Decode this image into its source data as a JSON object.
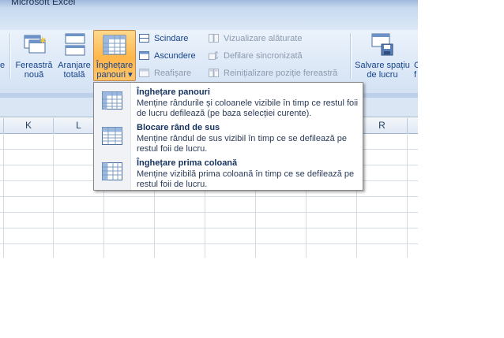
{
  "window": {
    "title": "Microsoft Excel"
  },
  "ribbon": {
    "fereastra_noua": "Fereastră\nnouă",
    "aranjare_totala": "Aranjare\ntotală",
    "inghetare_panouri": "Înghețare\npanouri ▾",
    "scindare": "Scindare",
    "ascundere": "Ascundere",
    "reafisare": "Reafișare",
    "vizualizare_alaturate": "Vizualizare alăturate",
    "defilare_sincronizata": "Defilare sincronizată",
    "reinitializare": "Reinițializare poziție fereastră",
    "salvare_spatiu": "Salvare spațiu\nde lucru",
    "cut_left": "e",
    "cut_right_1": "C",
    "cut_right_2": "f"
  },
  "grid": {
    "columns": [
      "K",
      "L",
      "",
      "",
      "",
      "",
      "",
      "R"
    ]
  },
  "menu": {
    "items": [
      {
        "title": "Înghețare panouri",
        "desc": "Menține rândurile și coloanele vizibile în timp ce restul foii de lucru defilează (pe baza selecției curente)."
      },
      {
        "title": "Blocare rând de sus",
        "desc": "Menține rândul de sus vizibil în timp ce se defilează pe restul foii de lucru."
      },
      {
        "title": "Înghețare prima coloană",
        "desc": "Menține vizibilă prima coloană în timp ce se defilează pe restul foii de lucru."
      }
    ]
  },
  "colors": {
    "ribbon_text": "#15428b",
    "accent_orange": "#ffb64a",
    "menu_title": "#15325e"
  }
}
